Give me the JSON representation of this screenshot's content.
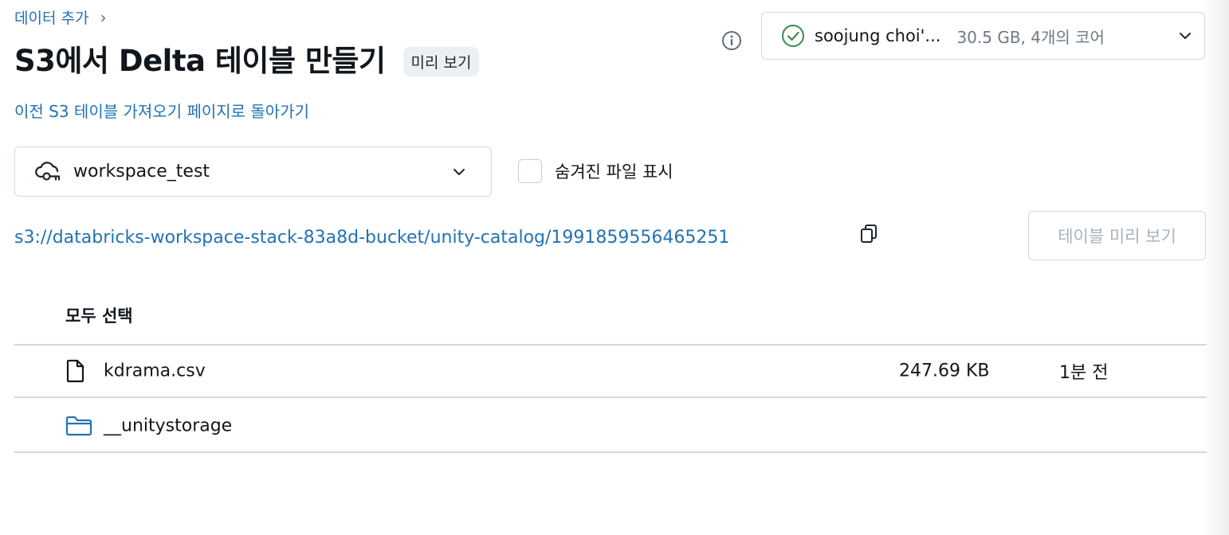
{
  "breadcrumb": {
    "label": "데이터 추가",
    "separator": "›"
  },
  "header": {
    "title": "S3에서 Delta 테이블 만들기",
    "badge": "미리 보기",
    "back_link": "이전 S3 테이블 가져오기 페이지로 돌아가기"
  },
  "compute": {
    "name": "soojung choi'...",
    "size": "30.5 GB, 4개의 코어",
    "status_icon": "check-circle-icon",
    "status_color": "#3b8a4e"
  },
  "location": {
    "selected": "workspace_test",
    "icon": "cloud-key-icon"
  },
  "hidden_files": {
    "label": "숨겨진 파일 표시",
    "checked": false
  },
  "path": {
    "value": "s3://databricks-workspace-stack-83a8d-bucket/unity-catalog/1991859556465251",
    "copy_icon": "copy-icon"
  },
  "preview_button": {
    "label": "테이블 미리 보기",
    "disabled": true
  },
  "files": {
    "select_all_label": "모두 선택",
    "rows": [
      {
        "type": "file",
        "icon": "file-icon",
        "name": "kdrama.csv",
        "size": "247.69 KB",
        "modified": "1분 전"
      },
      {
        "type": "folder",
        "icon": "folder-icon",
        "name": "__unitystorage",
        "size": "",
        "modified": ""
      }
    ]
  },
  "colors": {
    "link": "#2272b4",
    "folder": "#2272b4",
    "border": "#d1d9e1"
  }
}
